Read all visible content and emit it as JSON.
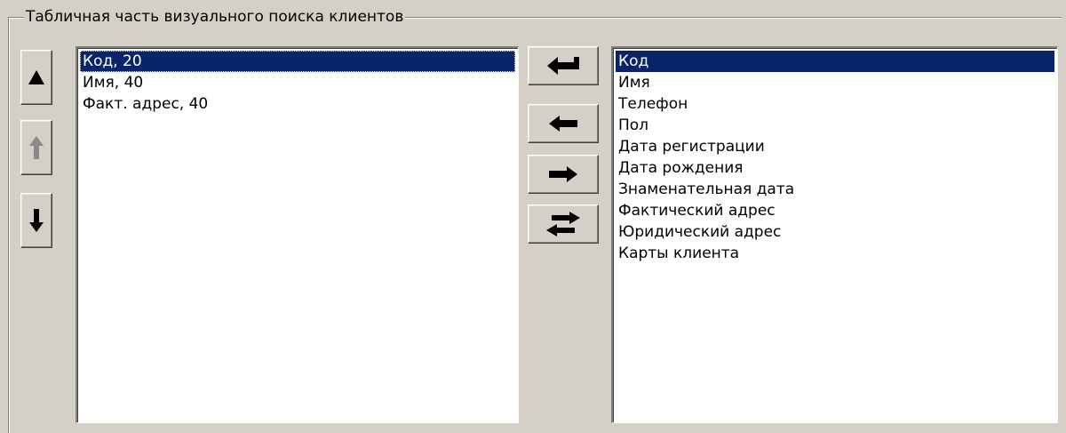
{
  "group": {
    "title": "Табличная часть визуального поиска клиентов"
  },
  "order_buttons": {
    "move_top": "arrow-up-icon",
    "move_up": "arrow-up-thin-icon",
    "move_down": "arrow-down-icon",
    "move_up_enabled": false
  },
  "selected_columns": {
    "items": [
      "Код, 20",
      "Имя, 40",
      "Факт. адрес, 40"
    ],
    "selected_index": 0
  },
  "transfer_buttons": {
    "add_enter": "return-arrow-icon",
    "add": "arrow-left-icon",
    "remove": "arrow-right-icon",
    "swap_all": "double-arrow-icon"
  },
  "available_fields": {
    "items": [
      "Код",
      "Имя",
      "Телефон",
      "Пол",
      "Дата регистрации",
      "Дата рождения",
      "Знаменательная дата",
      "Фактический адрес",
      "Юридический адрес",
      "Карты клиента"
    ],
    "selected_index": 0
  },
  "colors": {
    "window_bg": "#d4d0c8",
    "selection_bg": "#0a246a",
    "selection_fg": "#ffffff",
    "disabled_icon": "#808080"
  }
}
